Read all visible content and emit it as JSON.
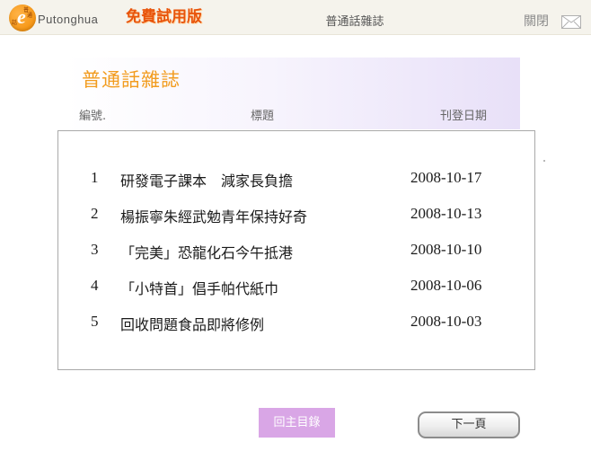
{
  "header": {
    "brand_name": "Putonghua",
    "logo_tiny_chars": [
      "普",
      "通",
      "話"
    ],
    "trial_badge": "免費試用版",
    "title": "普通話雜誌",
    "close_label": "關閉",
    "close_icon": "envelope-icon"
  },
  "magazine": {
    "title": "普通話雜誌",
    "columns": {
      "number": "編號.",
      "title": "標題",
      "date": "刊登日期"
    },
    "articles": [
      {
        "number": "1",
        "title": "研發電子課本　減家長負擔",
        "date": "2008-10-17"
      },
      {
        "number": "2",
        "title": "楊振寧朱經武勉青年保持好奇",
        "date": "2008-10-13"
      },
      {
        "number": "3",
        "title": "「完美」恐龍化石今午抵港",
        "date": "2008-10-10"
      },
      {
        "number": "4",
        "title": "「小特首」倡手帕代紙巾",
        "date": "2008-10-06"
      },
      {
        "number": "5",
        "title": "回收問題食品即將修例",
        "date": "2008-10-03"
      }
    ]
  },
  "footer": {
    "back_label": "回主目錄",
    "next_label": "下一頁"
  },
  "colors": {
    "brand_orange": "#f28a00",
    "trial_red": "#e8540b",
    "title_orange": "#f29c1f",
    "header_purple": "#e8e0f8",
    "back_button_purple": "#d9a6e6"
  }
}
